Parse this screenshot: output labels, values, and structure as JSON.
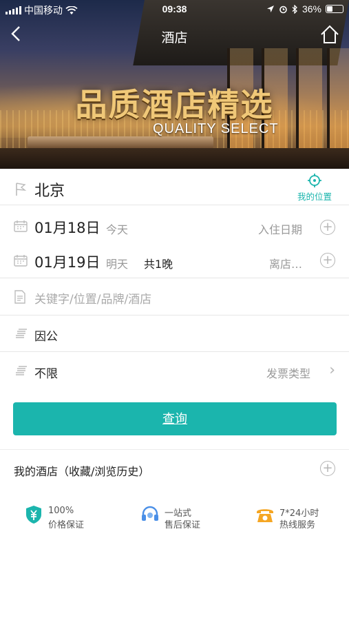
{
  "status_bar": {
    "carrier": "中国移动",
    "time": "09:38",
    "battery": "36%"
  },
  "nav": {
    "title": "酒店",
    "back_icon": "back-chevron-icon",
    "home_icon": "home-icon"
  },
  "banner": {
    "headline": "品质酒店精选",
    "subline": "QUALITY SELECT"
  },
  "form": {
    "city": "北京",
    "my_location_label": "我的位置",
    "checkin": {
      "date": "01月18日",
      "relative": "今天",
      "label": "入住日期"
    },
    "checkout": {
      "date": "01月19日",
      "relative": "明天",
      "nights": "共1晚",
      "label": "离店…"
    },
    "keyword_placeholder": "关键字/位置/品牌/酒店",
    "travel_purpose": "因公",
    "invoice_value": "不限",
    "invoice_label": "发票类型"
  },
  "search_button": "查询",
  "my_hotels": "我的酒店（收藏/浏览历史）",
  "features": [
    {
      "line1": "100%",
      "line2": "价格保证",
      "icon": "price-shield-icon"
    },
    {
      "line1": "一站式",
      "line2": "售后保证",
      "icon": "headset-icon"
    },
    {
      "line1": "7*24小时",
      "line2": "热线服务",
      "icon": "telephone-icon"
    }
  ],
  "colors": {
    "accent": "#1bb5ad",
    "icon_orange": "#f5a623",
    "icon_blue": "#4a8fe7"
  }
}
